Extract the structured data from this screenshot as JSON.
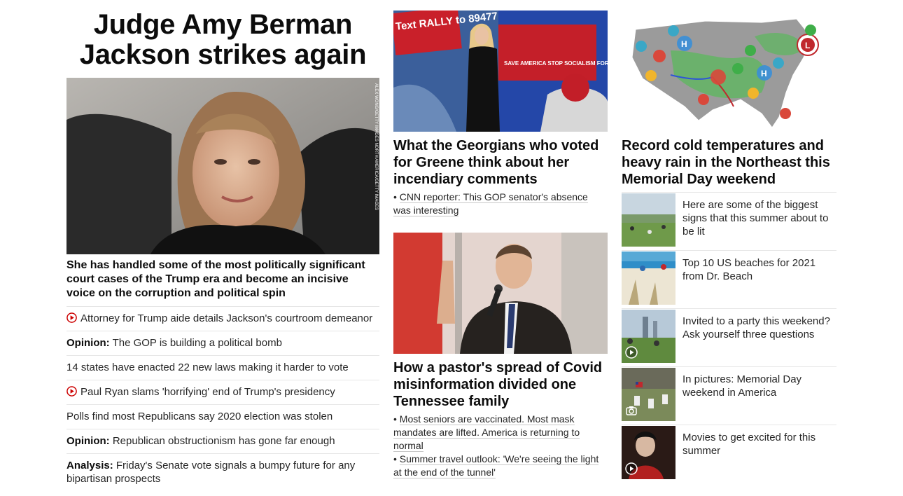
{
  "lead": {
    "headline": "Judge Amy Berman Jackson strikes again",
    "photo_credit": "ALEX WONG/GETTY IMAGES NORTH AMERICA/GETTY IMAGES",
    "subhead": "She has handled some of the most politically significant court cases of the Trump era and become an incisive voice on the corruption and political spin",
    "items": [
      {
        "prefix": "",
        "text": "Attorney for Trump aide details Jackson's courtroom demeanor",
        "icon": "play-icon"
      },
      {
        "prefix": "Opinion:",
        "text": "The GOP is building a political bomb",
        "icon": ""
      },
      {
        "prefix": "",
        "text": "14 states have enacted 22 new laws making it harder to vote",
        "icon": ""
      },
      {
        "prefix": "",
        "text": "Paul Ryan slams 'horrifying' end of Trump's presidency",
        "icon": "play-icon"
      },
      {
        "prefix": "",
        "text": "Polls find most Republicans say 2020 election was stolen",
        "icon": ""
      },
      {
        "prefix": "Opinion:",
        "text": "Republican obstructionism has gone far enough",
        "icon": ""
      },
      {
        "prefix": "Analysis:",
        "text": "Friday's Senate vote signals a bumpy future for any bipartisan prospects",
        "icon": ""
      }
    ]
  },
  "story2": {
    "sign_text_1": "Text RALLY to 89477",
    "sign_text_2": "SAVE AMERICA STOP SOCIALISM FOR CONGRESS",
    "headline": "What the Georgians who voted for Greene think about her incendiary comments",
    "related": [
      "CNN reporter: This GOP senator's absence was interesting"
    ]
  },
  "story3": {
    "headline": "How a pastor's spread of Covid misinformation divided one Tennessee family",
    "related": [
      "Most seniors are vaccinated. Most mask mandates are lifted. America is returning to normal",
      "Summer travel outlook: 'We're seeing the light at the end of the tunnel'"
    ]
  },
  "story4": {
    "headline": "Record cold temperatures and heavy rain in the Northeast this Memorial Day weekend",
    "map_labels": {
      "high": "H",
      "low": "L"
    },
    "cards": [
      {
        "title": "Here are some of the biggest signs that this summer about to be lit",
        "badge": ""
      },
      {
        "title": "Top 10 US beaches for 2021 from Dr. Beach",
        "badge": ""
      },
      {
        "title": "Invited to a party this weekend? Ask yourself three questions",
        "badge": "play-icon"
      },
      {
        "title": "In pictures: Memorial Day weekend in America",
        "badge": "camera-icon"
      },
      {
        "title": "Movies to get excited for this summer",
        "badge": "play-icon"
      }
    ]
  },
  "colors": {
    "accent_red": "#cc0000",
    "text": "#0c0c0c",
    "divider": "#e6e6e6"
  }
}
